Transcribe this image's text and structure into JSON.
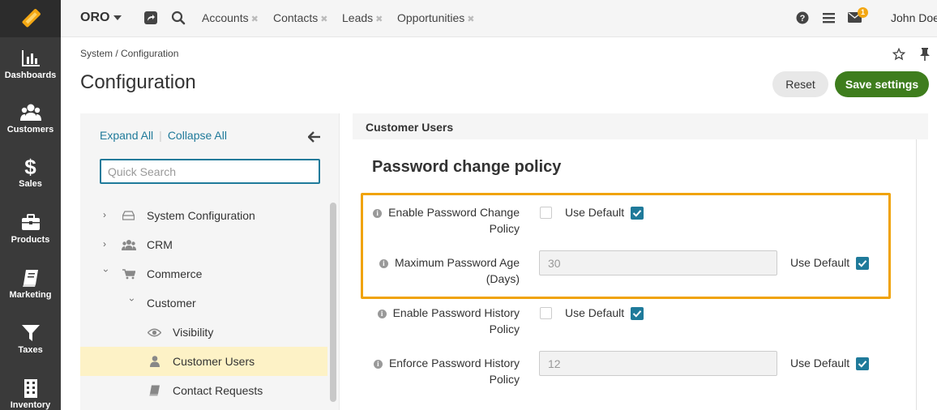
{
  "leftnav": {
    "items": [
      {
        "label": "Dashboards",
        "icon": "dashboards-icon"
      },
      {
        "label": "Customers",
        "icon": "customers-icon"
      },
      {
        "label": "Sales",
        "icon": "dollar-icon"
      },
      {
        "label": "Products",
        "icon": "briefcase-icon"
      },
      {
        "label": "Marketing",
        "icon": "book-icon"
      },
      {
        "label": "Taxes",
        "icon": "filter-icon"
      },
      {
        "label": "Inventory",
        "icon": "building-icon"
      }
    ]
  },
  "topbar": {
    "brand": "ORO",
    "tabs": [
      "Accounts",
      "Contacts",
      "Leads",
      "Opportunities"
    ],
    "notification_count": "1",
    "user": "John Doe"
  },
  "header": {
    "breadcrumb": "System / Configuration",
    "title": "Configuration",
    "reset_label": "Reset",
    "save_label": "Save settings"
  },
  "tree": {
    "expand_all": "Expand All",
    "collapse_all": "Collapse All",
    "search_placeholder": "Quick Search",
    "items": [
      {
        "label": "System Configuration"
      },
      {
        "label": "CRM"
      },
      {
        "label": "Commerce"
      },
      {
        "label": "Customer"
      },
      {
        "label": "Visibility"
      },
      {
        "label": "Customer Users"
      },
      {
        "label": "Contact Requests"
      }
    ]
  },
  "content": {
    "section_header": "Customer Users",
    "group_title": "Password change policy",
    "use_default_label": "Use Default",
    "fields": [
      {
        "label_line1": "Enable Password Change",
        "label_line2": "Policy"
      },
      {
        "label_line1": "Maximum Password Age",
        "label_line2": "(Days)",
        "value": "30"
      },
      {
        "label_line1": "Enable Password History",
        "label_line2": "Policy"
      },
      {
        "label_line1": "Enforce Password History",
        "label_line2": "Policy",
        "value": "12"
      }
    ]
  },
  "colors": {
    "accent": "#1f7a9a",
    "save": "#3e7d1d",
    "highlight": "#f0a30a",
    "nav_bg": "#3a3a3a"
  }
}
